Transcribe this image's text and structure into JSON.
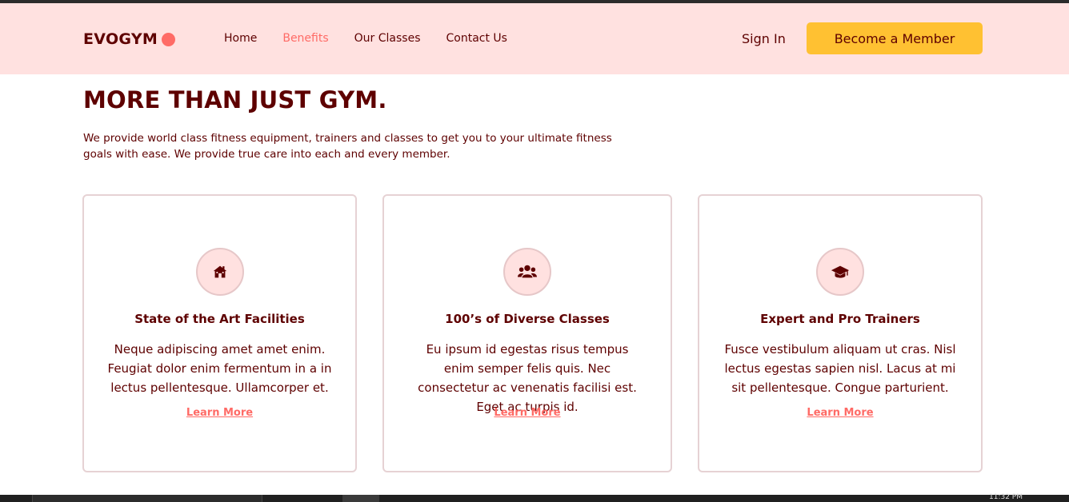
{
  "navbar": {
    "logo": "EVOGYM",
    "links": [
      "Home",
      "Benefits",
      "Our Classes",
      "Contact Us"
    ],
    "active_link": "Benefits",
    "sign_in": "Sign In",
    "cta": "Become a Member"
  },
  "hero": {
    "heading": "MORE THAN JUST GYM.",
    "intro": "We provide world class fitness equipment, trainers and classes to get you to your ultimate fitness goals with ease. We provide true care into each and every member."
  },
  "cards": [
    {
      "icon": "home-icon",
      "title": "State of the Art Facilities",
      "description": "Neque adipiscing amet amet enim. Feugiat dolor enim fermentum in a in lectus pellentesque. Ullamcorper et.",
      "link": "Learn More"
    },
    {
      "icon": "user-group-icon",
      "title": "100’s of Diverse Classes",
      "description": "Eu ipsum id egestas risus tempus enim semper felis quis. Nec consectetur ac venenatis facilisi est. Eget ac turpis id.",
      "link": "Learn More"
    },
    {
      "icon": "graduation-cap-icon",
      "title": "Expert and Pro Trainers",
      "description": "Fusce vestibulum aliquam ut cras. Nisl lectus egestas sapien nisl. Lacus at mi sit pellentesque. Congue parturient.",
      "link": "Learn More"
    }
  ],
  "taskbar": {
    "clock": "11:32 PM"
  },
  "colors": {
    "primary_dark": "#5e0000",
    "accent_red": "#ff6b66",
    "nav_bg": "#ffe1e0",
    "cta_yellow": "#ffc132"
  }
}
